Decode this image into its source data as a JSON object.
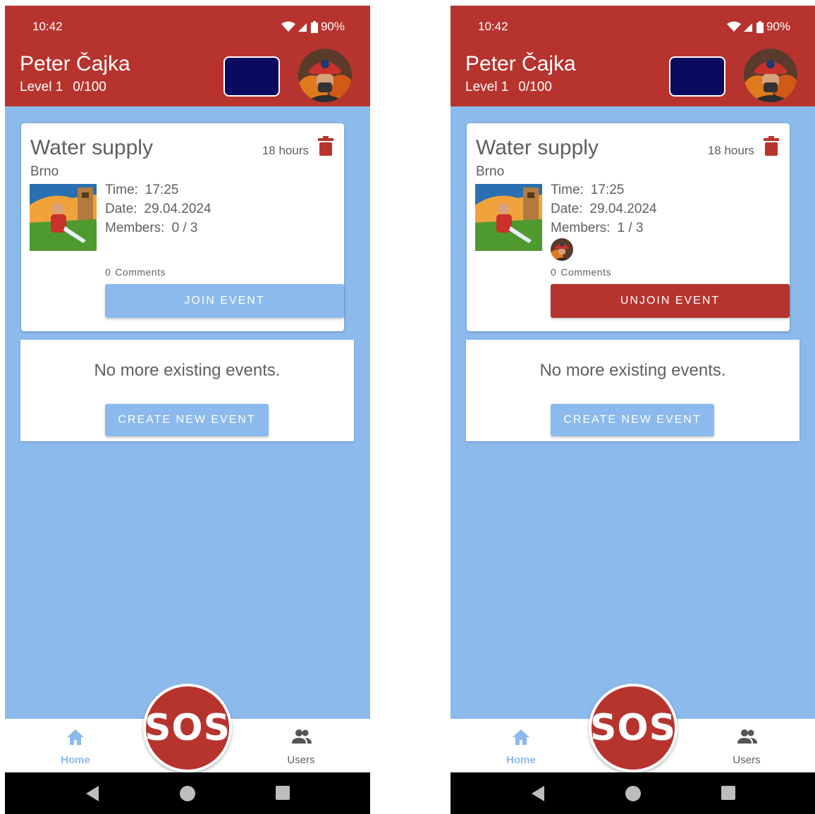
{
  "status": {
    "time": "10:42",
    "battery": "90%"
  },
  "user": {
    "name": "Peter Čajka",
    "level": "Level 1",
    "progress": "0/100"
  },
  "event": {
    "title": "Water supply",
    "age": "18 hours",
    "city": "Brno",
    "time_label": "Time:",
    "time_value": "17:25",
    "date_label": "Date:",
    "date_value": "29.04.2024",
    "members_label": "Members:",
    "comments_count": "0",
    "comments_label": "Comments"
  },
  "screens": [
    {
      "members_value": "0 / 3",
      "action_label": "JOIN EVENT"
    },
    {
      "members_value": "1 / 3",
      "action_label": "UNJOIN EVENT"
    }
  ],
  "empty": {
    "message": "No more existing events.",
    "create_label": "CREATE NEW EVENT"
  },
  "nav": {
    "home": "Home",
    "users": "Users",
    "sos": "SOS"
  },
  "colors": {
    "primary": "#b7342e",
    "background": "#8cbaec",
    "dark_button": "#0a0b5e"
  },
  "icons": [
    "wifi-icon",
    "signal-icon",
    "battery-icon",
    "trash-icon",
    "home-icon",
    "users-icon",
    "back-icon",
    "home-circle-icon",
    "recents-icon"
  ]
}
